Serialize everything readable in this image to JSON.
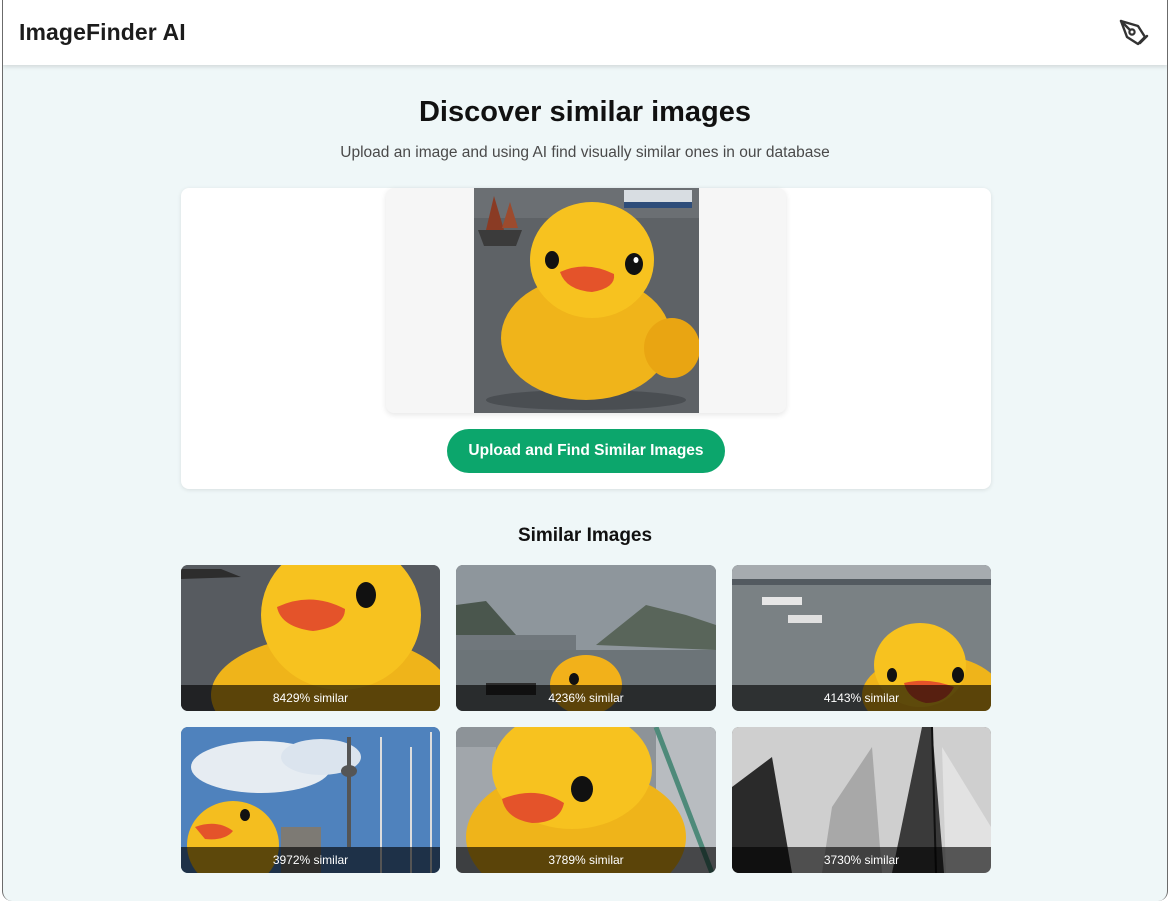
{
  "header": {
    "brand": "ImageFinder AI",
    "icon": "pen-nib-icon"
  },
  "hero": {
    "title": "Discover similar images",
    "subtitle": "Upload an image and using AI find visually similar ones in our database"
  },
  "upload": {
    "button_label": "Upload and Find Similar Images"
  },
  "results": {
    "title": "Similar Images",
    "items": [
      {
        "caption": "8429% similar"
      },
      {
        "caption": "4236% similar"
      },
      {
        "caption": "4143% similar"
      },
      {
        "caption": "3972% similar"
      },
      {
        "caption": "3789% similar"
      },
      {
        "caption": "3730% similar"
      }
    ]
  },
  "colors": {
    "accent": "#0ca66c",
    "background": "#eff7f8",
    "duck": "#f7bf1e"
  }
}
